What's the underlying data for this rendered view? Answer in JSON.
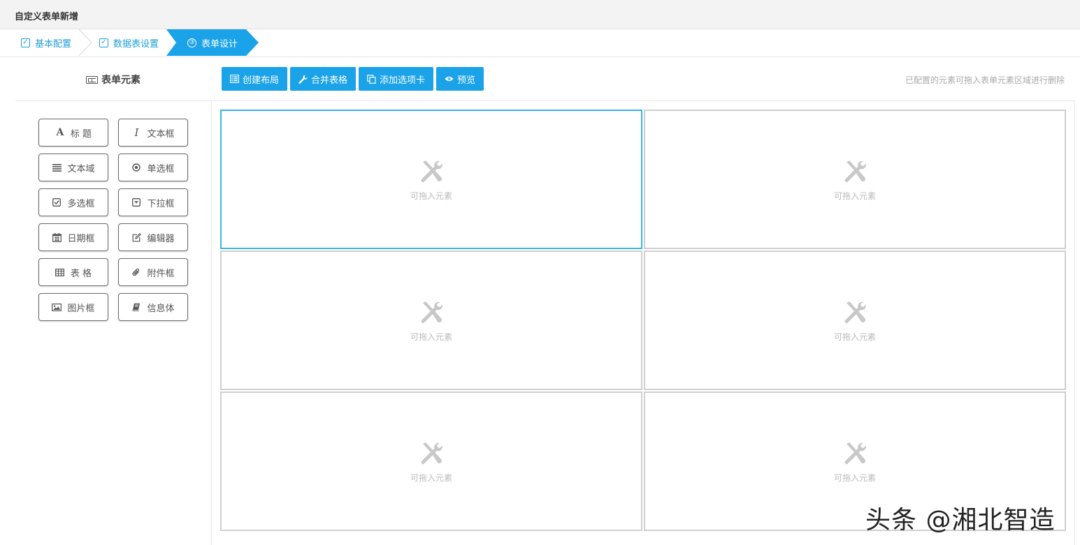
{
  "title": "自定义表单新增",
  "steps": [
    {
      "label": "基本配置",
      "icon": "check-square-icon"
    },
    {
      "label": "数据表设置",
      "icon": "check-square-icon"
    },
    {
      "label": "表单设计",
      "icon": "circled-three-icon",
      "number": "③",
      "active": true
    }
  ],
  "left_panel": {
    "title": "表单元素",
    "elements": [
      {
        "label": "标 题",
        "icon": "font-icon"
      },
      {
        "label": "文本框",
        "icon": "italic-icon"
      },
      {
        "label": "文本域",
        "icon": "align-justify-icon"
      },
      {
        "label": "单选框",
        "icon": "dot-circle-icon"
      },
      {
        "label": "多选框",
        "icon": "check-square-icon"
      },
      {
        "label": "下拉框",
        "icon": "caret-square-down-icon"
      },
      {
        "label": "日期框",
        "icon": "calendar-icon"
      },
      {
        "label": "编辑器",
        "icon": "edit-icon"
      },
      {
        "label": "表 格",
        "icon": "table-icon"
      },
      {
        "label": "附件框",
        "icon": "paperclip-icon"
      },
      {
        "label": "图片框",
        "icon": "image-icon"
      },
      {
        "label": "信息体",
        "icon": "book-icon"
      }
    ]
  },
  "toolbar": {
    "create_layout": "创建布局",
    "merge_cells": "合并表格",
    "add_tab": "添加选项卡",
    "preview": "预览"
  },
  "hint": "已配置的元素可拖入表单元素区域进行删除",
  "grid": {
    "cells": [
      {
        "text": "可拖入元素",
        "active": true
      },
      {
        "text": "可拖入元素",
        "active": false
      },
      {
        "text": "可拖入元素",
        "active": false
      },
      {
        "text": "可拖入元素",
        "active": false
      },
      {
        "text": "可拖入元素",
        "active": false
      },
      {
        "text": "可拖入元素",
        "active": false
      }
    ]
  },
  "watermark": "头条 @湘北智造",
  "colors": {
    "accent": "#1aa3e8",
    "active_border": "#3ab4dd"
  }
}
